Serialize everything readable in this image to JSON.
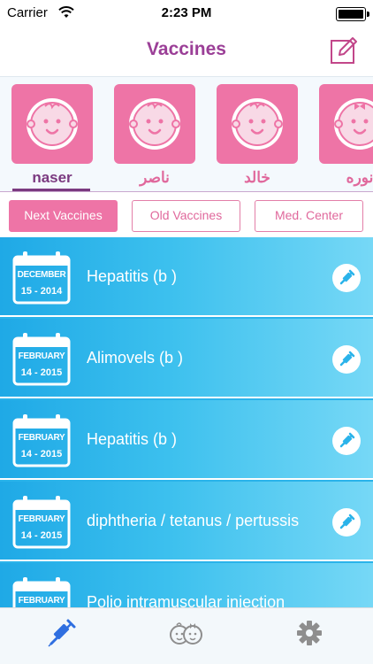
{
  "status_bar": {
    "carrier": "Carrier",
    "time": "2:23 PM"
  },
  "nav": {
    "title": "Vaccines",
    "compose_icon": "compose-icon"
  },
  "children": [
    {
      "name": "naser",
      "selected": true,
      "avatar": "baby-boy-icon"
    },
    {
      "name": "ناصر",
      "selected": false,
      "avatar": "baby-boy-icon"
    },
    {
      "name": "خالد",
      "selected": false,
      "avatar": "baby-boy-icon"
    },
    {
      "name": "نوره",
      "selected": false,
      "avatar": "baby-girl-icon"
    }
  ],
  "segments": [
    {
      "label": "Next Vaccines",
      "active": true
    },
    {
      "label": "Old Vaccines",
      "active": false
    },
    {
      "label": "Med. Center",
      "active": false
    }
  ],
  "vaccines": [
    {
      "month": "DECEMBER",
      "date": "15 - 2014",
      "name": "Hepatitis (b )"
    },
    {
      "month": "FEBRUARY",
      "date": "14 - 2015",
      "name": "Alimovels (b )"
    },
    {
      "month": "FEBRUARY",
      "date": "14 - 2015",
      "name": "Hepatitis (b )"
    },
    {
      "month": "FEBRUARY",
      "date": "14 - 2015",
      "name": "diphtheria / tetanus / pertussis"
    },
    {
      "month": "FEBRUARY",
      "date": "",
      "name": "Polio intramuscular injection"
    }
  ],
  "tab_bar": {
    "tabs": [
      {
        "icon": "syringe-icon",
        "active": true
      },
      {
        "icon": "babies-icon",
        "active": false
      },
      {
        "icon": "gear-icon",
        "active": false
      }
    ]
  },
  "colors": {
    "accent_pink": "#ee74a6",
    "title_purple": "#9b3f97",
    "list_blue": "#2ab3ea",
    "active_tab_blue": "#2f6fe0"
  }
}
